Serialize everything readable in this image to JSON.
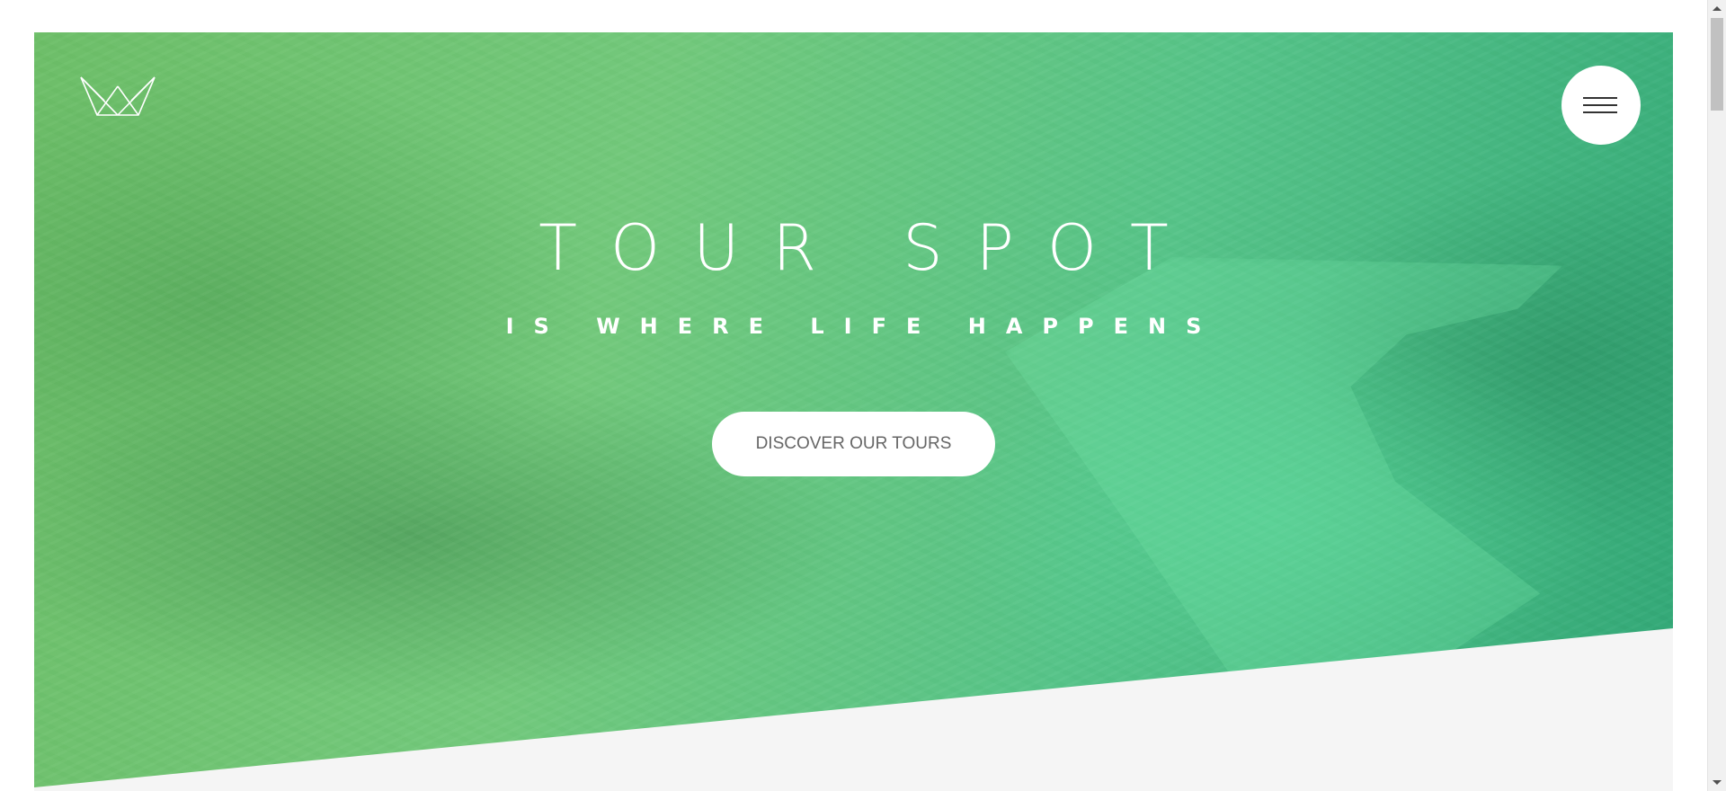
{
  "header": {
    "logo": "crown-logo",
    "menu_icon": "hamburger-menu-icon"
  },
  "hero": {
    "title": "TOUR SPOT",
    "subtitle": "IS WHERE LIFE HAPPENS",
    "cta_label": "DISCOVER OUR TOURS"
  },
  "colors": {
    "hero_gradient_start": "#6fbf6a",
    "hero_gradient_end": "#33a878",
    "page_background": "#f5f5f5",
    "button_background": "#ffffff",
    "button_text": "#666666",
    "title_text": "#ffffff"
  },
  "scrollbar": {
    "arrow_up": "scroll-up-arrow",
    "arrow_down": "scroll-down-arrow"
  }
}
